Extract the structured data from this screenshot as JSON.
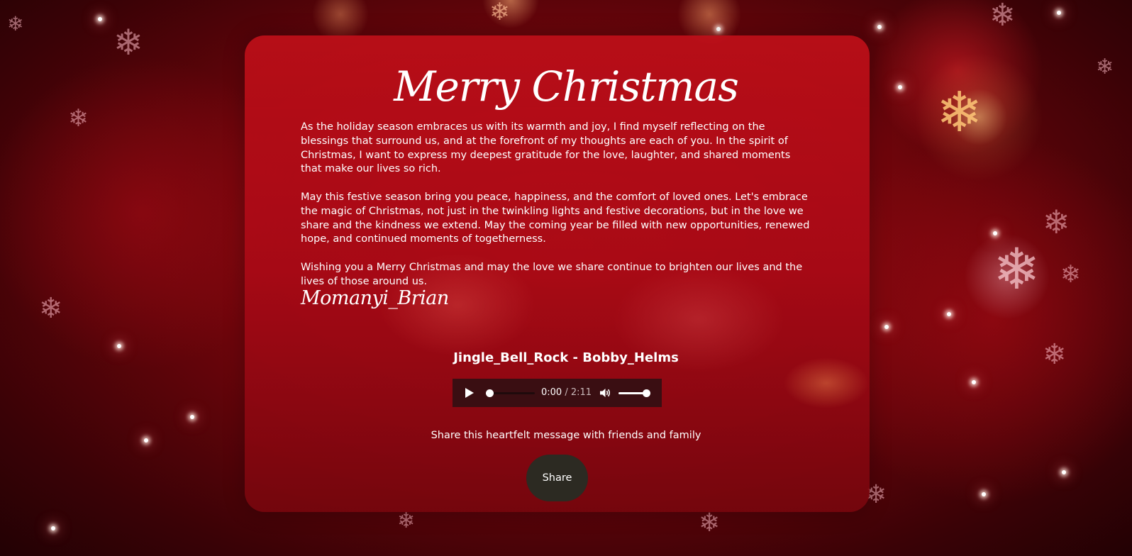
{
  "card": {
    "title": "Merry Christmas",
    "paragraphs": [
      "As the holiday season embraces us with its warmth and joy, I find myself reflecting on the blessings that surround us, and at the forefront of my thoughts are each of you. In the spirit of Christmas, I want to express my deepest gratitude for the love, laughter, and shared moments that make our lives so rich.",
      "May this festive season bring you peace, happiness, and the comfort of loved ones. Let's embrace the magic of Christmas, not just in the twinkling lights and festive decorations, but in the love we share and the kindness we extend. May the coming year be filled with new opportunities, renewed hope, and continued moments of togetherness.",
      "Wishing you a Merry Christmas and may the love we share continue to brighten our lives and the lives of those around us."
    ],
    "signature": "Momanyi_Brian"
  },
  "music": {
    "song_title": "Jingle_Bell_Rock - Bobby_Helms",
    "current_time": "0:00",
    "separator": "/",
    "duration": "2:11",
    "progress_fraction": 0,
    "volume_fraction": 1,
    "play_icon": "play-icon",
    "volume_icon": "volume-icon"
  },
  "share": {
    "prompt": "Share this heartfelt message with friends and family",
    "button_label": "Share"
  },
  "colors": {
    "background": "#7a060d",
    "card": "#b50f1a",
    "player_background": "#3a0e12",
    "share_button": "#2c2a22",
    "text": "#ffffff"
  }
}
